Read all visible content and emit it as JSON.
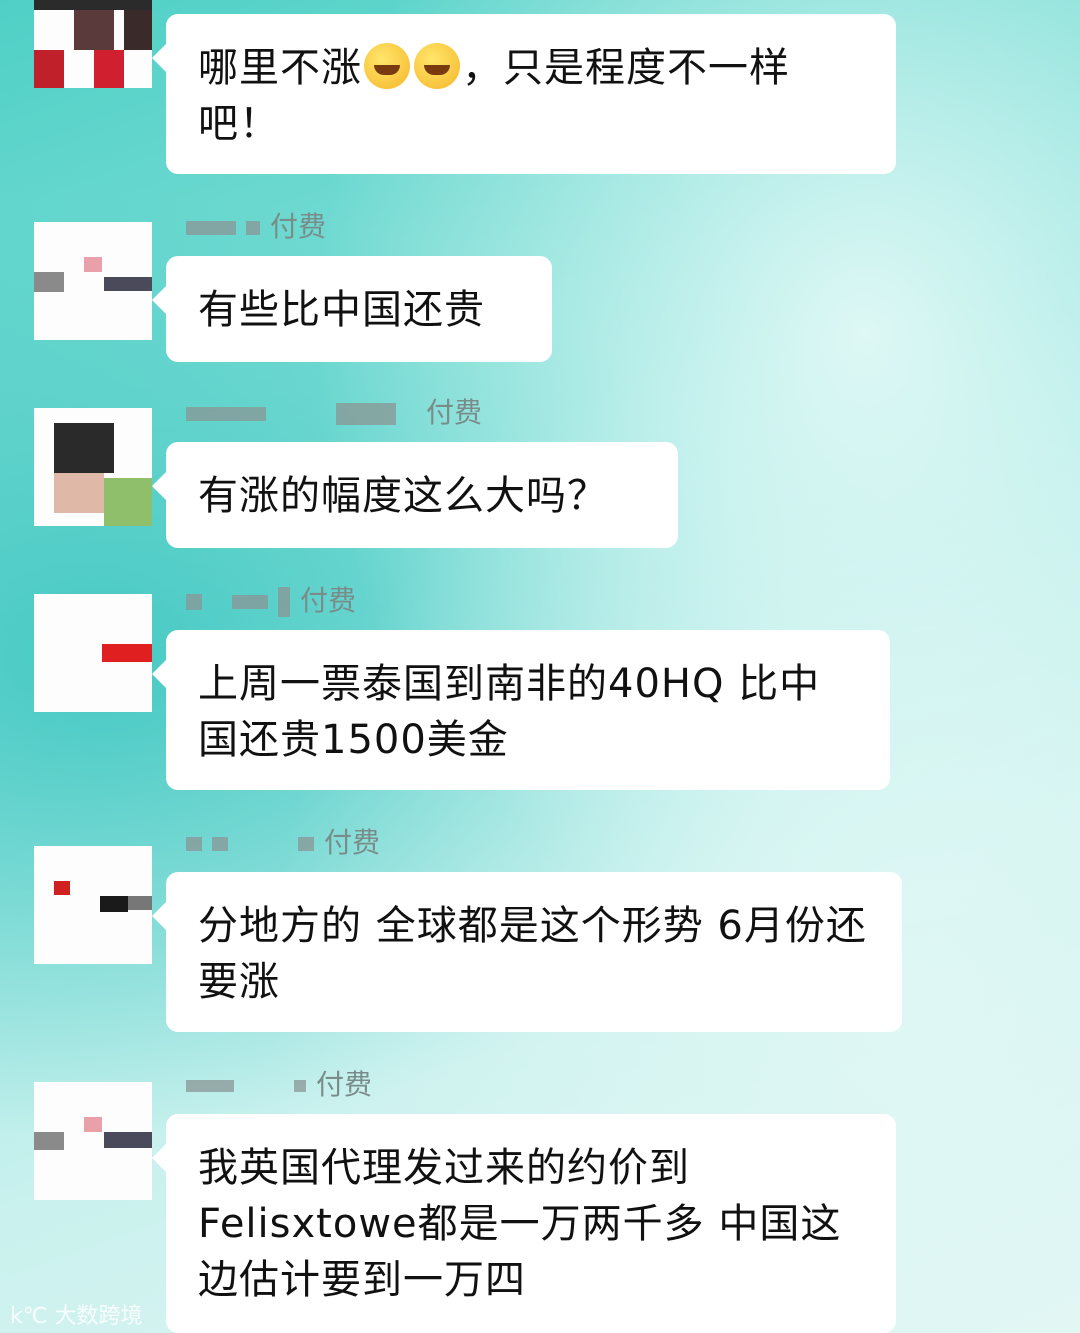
{
  "messages": [
    {
      "sender_label": "",
      "text": "哪里不涨",
      "text_after_emoji": "，只是程度不一样吧！",
      "emoji": [
        "laughing-crying-emoji",
        "laughing-crying-emoji"
      ]
    },
    {
      "sender_label": "付费",
      "text": "有些比中国还贵"
    },
    {
      "sender_label": "付费",
      "text": "有涨的幅度这么大吗？"
    },
    {
      "sender_label": "付费",
      "text": "上周一票泰国到南非的40HQ 比中国还贵1500美金"
    },
    {
      "sender_label": "付费",
      "text": "分地方的 全球都是这个形势 6月份还要涨"
    },
    {
      "sender_label": "付费",
      "text": "我英国代理发过来的约价到Felisxtowe都是一万两千多 中国这边估计要到一万四"
    }
  ],
  "watermark": "大数跨境"
}
